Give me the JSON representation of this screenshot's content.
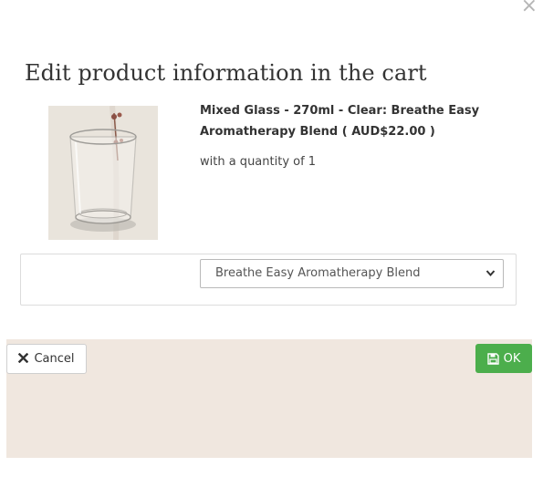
{
  "modal": {
    "close_symbol": "×",
    "title": "Edit product information in the cart"
  },
  "product": {
    "image_alt": "Mixed Glass - 270ml - Clear",
    "name": "Mixed Glass - 270ml - Clear: Breathe Easy Aromatherapy Blend ( AUD$22.00 )",
    "quantity_text": "with a quantity of 1"
  },
  "options": {
    "selected": "Breathe Easy Aromatherapy Blend"
  },
  "footer": {
    "cancel_label": "Cancel",
    "cancel_icon": "times-icon",
    "ok_label": "OK",
    "ok_icon": "floppy-disk-icon",
    "background_color": "#f0e7df",
    "ok_color": "#4cae4c"
  }
}
